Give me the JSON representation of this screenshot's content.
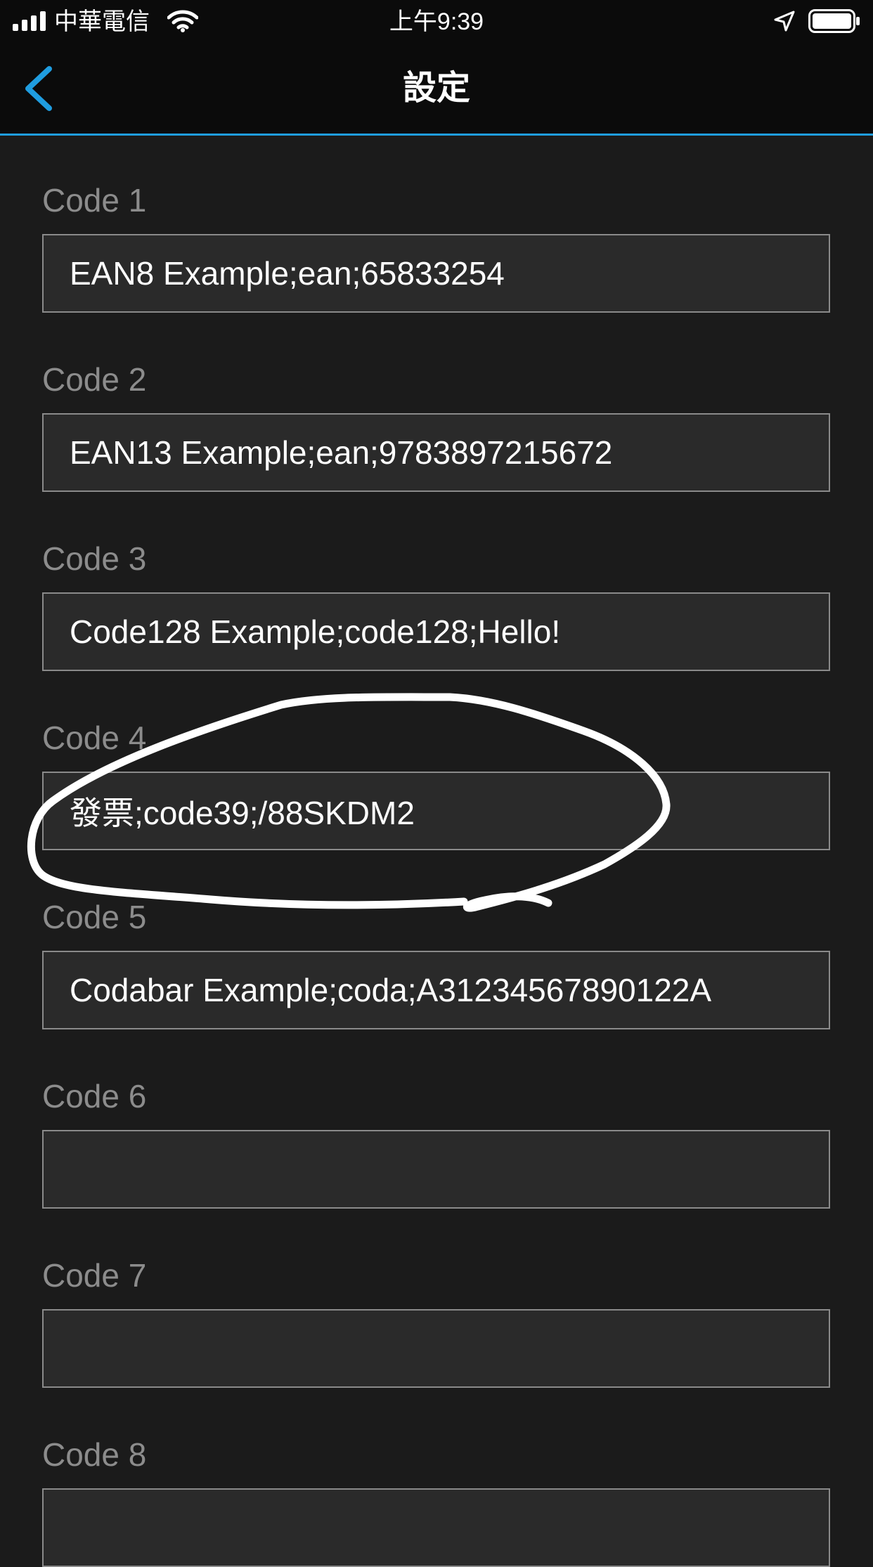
{
  "status_bar": {
    "carrier": "中華電信",
    "time": "上午9:39"
  },
  "nav": {
    "title": "設定",
    "back_icon": "chevron-left-icon",
    "accent_color": "#1f9de0"
  },
  "fields": [
    {
      "label": "Code 1",
      "value": "EAN8 Example;ean;65833254"
    },
    {
      "label": "Code 2",
      "value": "EAN13 Example;ean;9783897215672"
    },
    {
      "label": "Code 3",
      "value": "Code128 Example;code128;Hello!"
    },
    {
      "label": "Code 4",
      "value": "發票;code39;/88SKDM2"
    },
    {
      "label": "Code 5",
      "value": "Codabar Example;coda;A31234567890122A"
    },
    {
      "label": "Code 6",
      "value": ""
    },
    {
      "label": "Code 7",
      "value": ""
    },
    {
      "label": "Code 8",
      "value": ""
    }
  ]
}
